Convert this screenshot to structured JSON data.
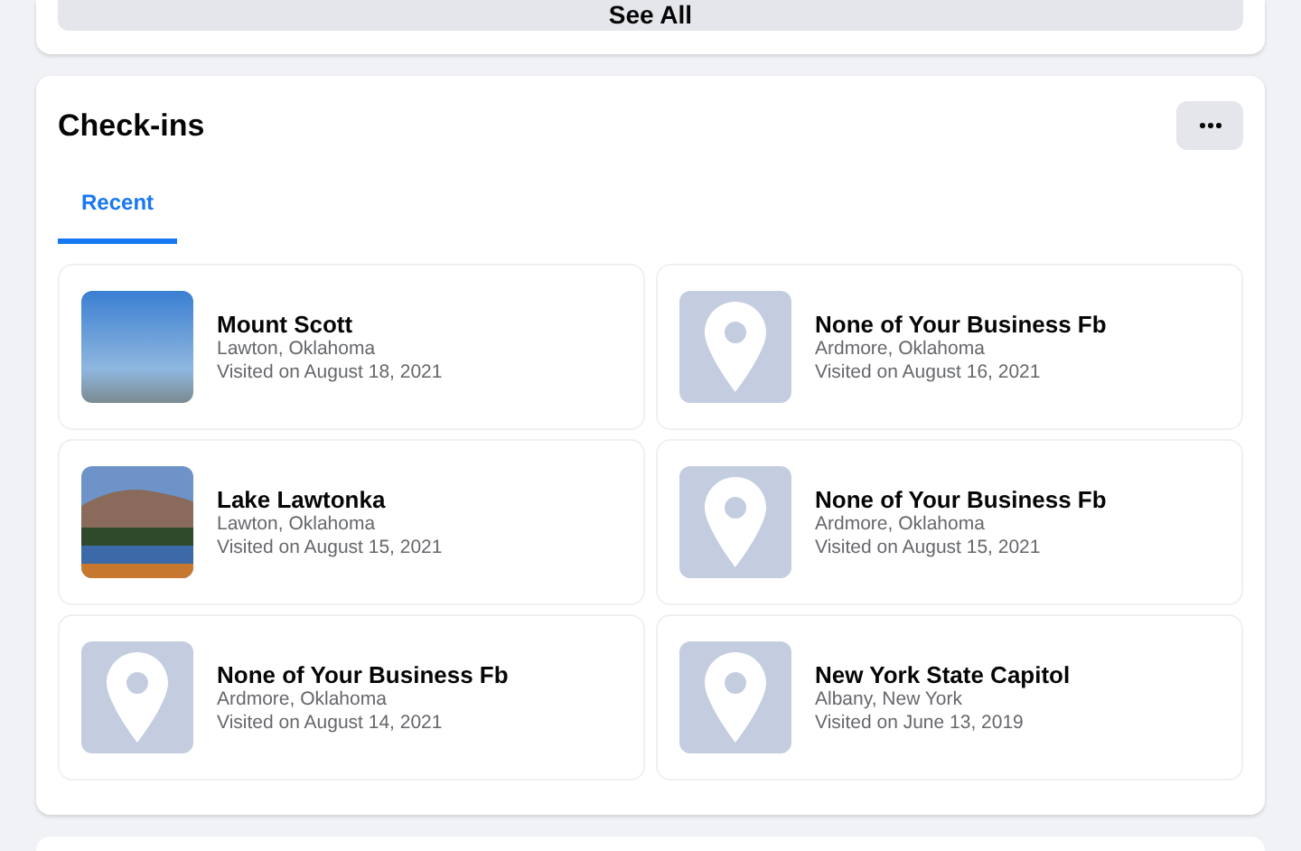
{
  "top_card": {
    "button": "See All"
  },
  "checkins": {
    "title": "Check-ins",
    "tabs": [
      {
        "label": "Recent",
        "selected": true
      }
    ],
    "places": [
      {
        "kind": "photo",
        "name": "Mount Scott",
        "location": "Lawton, Oklahoma",
        "visited": "Visited on August 18, 2021"
      },
      {
        "kind": "pin",
        "name": "None of Your Business Fb",
        "location": "Ardmore, Oklahoma",
        "visited": "Visited on August 16, 2021"
      },
      {
        "kind": "landscape",
        "name": "Lake Lawtonka",
        "location": "Lawton, Oklahoma",
        "visited": "Visited on August 15, 2021"
      },
      {
        "kind": "pin",
        "name": "None of Your Business Fb",
        "location": "Ardmore, Oklahoma",
        "visited": "Visited on August 15, 2021"
      },
      {
        "kind": "pin",
        "name": "None of Your Business Fb",
        "location": "Ardmore, Oklahoma",
        "visited": "Visited on August 14, 2021"
      },
      {
        "kind": "pin",
        "name": "New York State Capitol",
        "location": "Albany, New York",
        "visited": "Visited on June 13, 2019"
      }
    ]
  }
}
